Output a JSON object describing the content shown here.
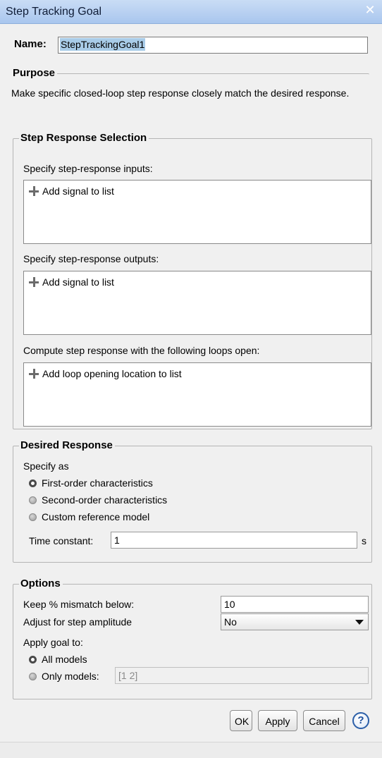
{
  "window": {
    "title": "Step Tracking Goal",
    "close_glyph": "✕"
  },
  "name": {
    "label": "Name:",
    "value": "StepTrackingGoal1"
  },
  "purpose": {
    "title": "Purpose",
    "text": "Make specific closed-loop step response closely match the desired response."
  },
  "step_response": {
    "title": "Step Response Selection",
    "inputs_label": "Specify step-response inputs:",
    "inputs_add": "Add signal to list",
    "outputs_label": "Specify step-response outputs:",
    "outputs_add": "Add signal to list",
    "loops_label": "Compute step response with the following loops open:",
    "loops_add": "Add loop opening location to list"
  },
  "desired_response": {
    "title": "Desired Response",
    "specify_as": "Specify as",
    "options": [
      {
        "label": "First-order characteristics",
        "selected": true
      },
      {
        "label": "Second-order characteristics",
        "selected": false
      },
      {
        "label": "Custom reference model",
        "selected": false
      }
    ],
    "time_constant_label": "Time constant:",
    "time_constant_value": "1",
    "time_constant_unit": "s"
  },
  "options": {
    "title": "Options",
    "mismatch_label": "Keep % mismatch below:",
    "mismatch_value": "10",
    "adjust_label": "Adjust for step amplitude",
    "adjust_value": "No",
    "apply_label": "Apply goal to:",
    "all_models": "All models",
    "only_models": "Only models:",
    "only_models_value": "[1 2]",
    "selected": "All models"
  },
  "buttons": {
    "ok": "OK",
    "apply": "Apply",
    "cancel": "Cancel",
    "help": "?"
  },
  "icons": {
    "add": "plus-icon",
    "help": "help-icon",
    "close": "close-icon",
    "dropdown": "chevron-down-icon"
  }
}
